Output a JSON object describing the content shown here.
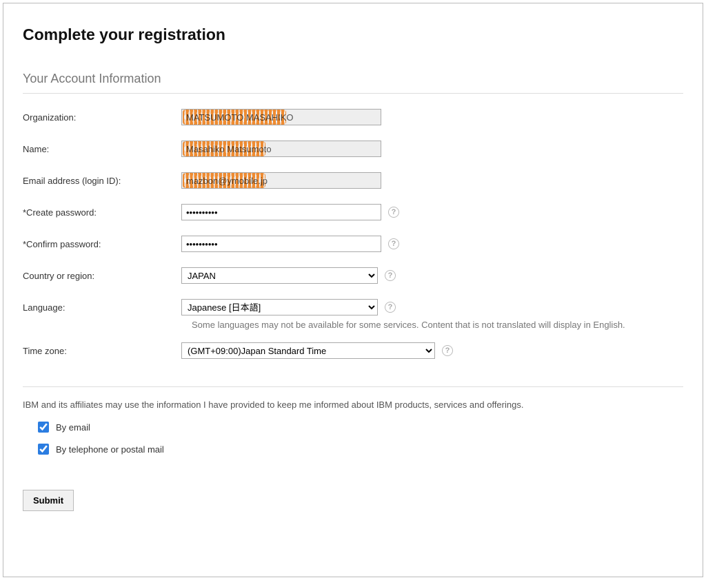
{
  "page": {
    "title": "Complete your registration"
  },
  "section": {
    "account_heading": "Your Account Information"
  },
  "labels": {
    "organization": "Organization:",
    "name": "Name:",
    "email": "Email address (login ID):",
    "create_password": "*Create password:",
    "confirm_password": "*Confirm password:",
    "country": "Country or region:",
    "language": "Language:",
    "timezone": "Time zone:"
  },
  "values": {
    "organization": "MATSUMOTO MASAHIKO",
    "name": "Masahiko Matsumoto",
    "email": "mazbon@ymobile.jp",
    "create_password": "••••••••••",
    "confirm_password": "••••••••••",
    "country": "JAPAN",
    "language": "Japanese [日本語]",
    "timezone": "(GMT+09:00)Japan Standard Time"
  },
  "notes": {
    "language_note": "Some languages may not be available for some services. Content that is not translated will display in English."
  },
  "consent": {
    "intro": "IBM and its affiliates may use the information I have provided to keep me informed about IBM products, services and offerings.",
    "by_email": "By email",
    "by_phone_mail": "By telephone or postal mail"
  },
  "buttons": {
    "submit": "Submit"
  },
  "help_glyph": "?"
}
